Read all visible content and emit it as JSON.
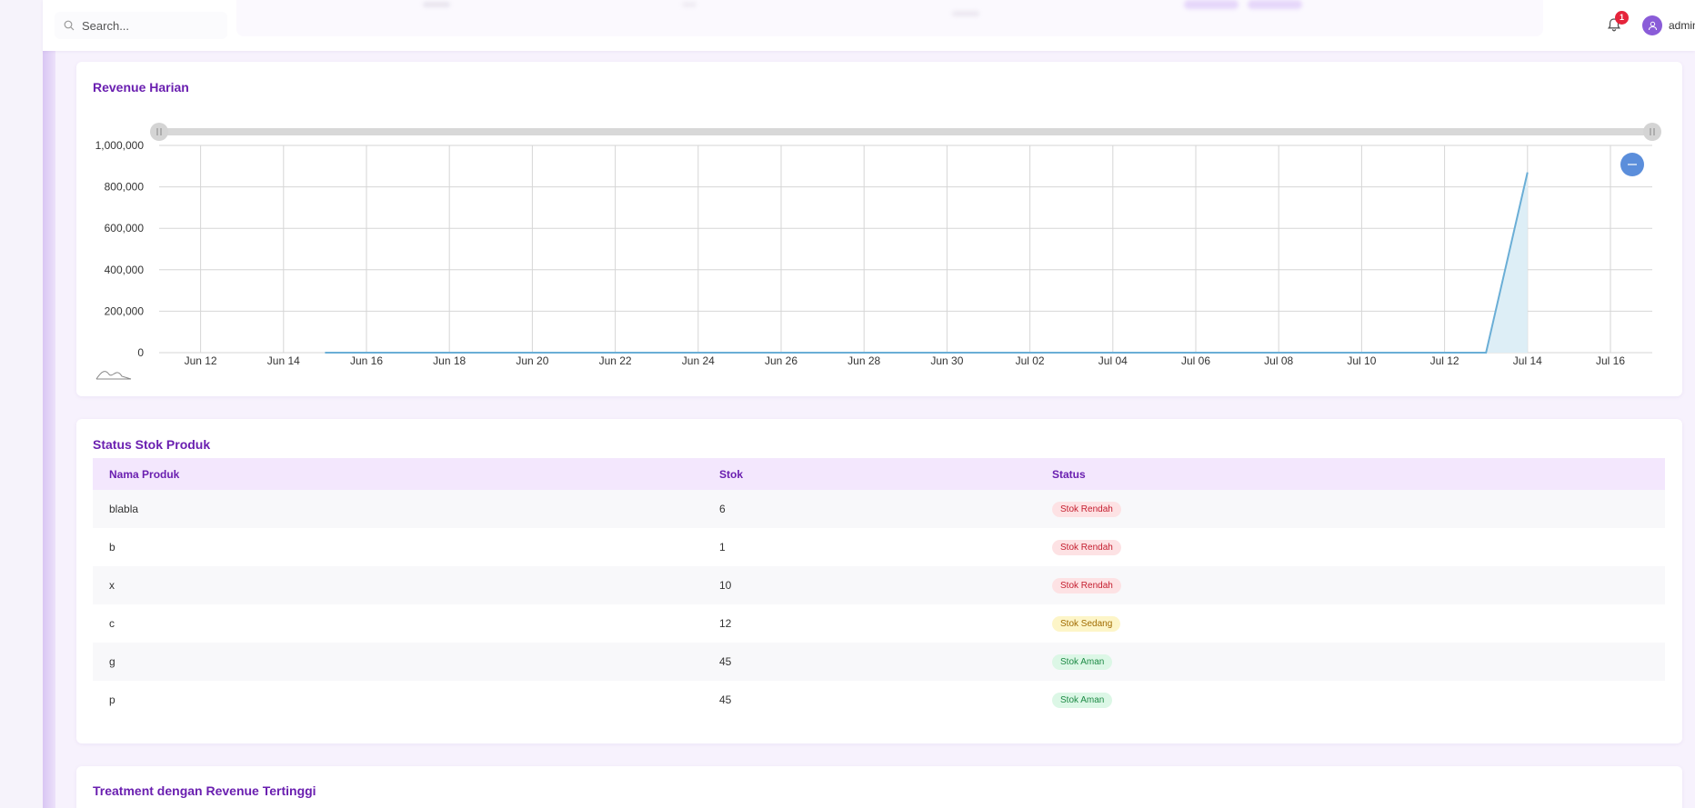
{
  "header": {
    "search_placeholder": "Search...",
    "notification_count": "1",
    "username": "admin",
    "icons": {
      "search": "search-icon",
      "bell": "bell-icon",
      "avatar": "user-icon"
    }
  },
  "revenue_card": {
    "title": "Revenue Harian",
    "icons": {
      "zoom_reset": "minus-circle-icon",
      "range_handle": "drag-handle-icon",
      "overview": "mini-sparkline-icon"
    }
  },
  "chart_data": {
    "type": "area",
    "x": [
      "Jun 15",
      "Jun 16",
      "Jun 17",
      "Jun 18",
      "Jun 19",
      "Jun 20",
      "Jun 21",
      "Jun 22",
      "Jun 23",
      "Jun 24",
      "Jun 25",
      "Jun 26",
      "Jun 27",
      "Jun 28",
      "Jun 29",
      "Jun 30",
      "Jul 01",
      "Jul 02",
      "Jul 03",
      "Jul 04",
      "Jul 05",
      "Jul 06",
      "Jul 07",
      "Jul 08",
      "Jul 09",
      "Jul 10",
      "Jul 11",
      "Jul 12",
      "Jul 13",
      "Jul 14"
    ],
    "values": [
      0,
      0,
      0,
      0,
      0,
      0,
      0,
      0,
      0,
      0,
      0,
      0,
      0,
      0,
      0,
      0,
      0,
      0,
      0,
      0,
      0,
      0,
      0,
      0,
      0,
      0,
      0,
      0,
      0,
      870000
    ],
    "x_ticks": [
      "Jun 12",
      "Jun 14",
      "Jun 16",
      "Jun 18",
      "Jun 20",
      "Jun 22",
      "Jun 24",
      "Jun 26",
      "Jun 28",
      "Jun 30",
      "Jul 02",
      "Jul 04",
      "Jul 06",
      "Jul 08",
      "Jul 10",
      "Jul 12",
      "Jul 14",
      "Jul 16"
    ],
    "y_ticks": [
      "0",
      "200,000",
      "400,000",
      "600,000",
      "800,000",
      "1,000,000"
    ],
    "ylim": [
      0,
      1000000
    ],
    "grid": true,
    "colors": {
      "line": "#6aaed6",
      "fill": "#ddeef6"
    }
  },
  "stock_card": {
    "title": "Status Stok Produk",
    "columns": [
      "Nama Produk",
      "Stok",
      "Status"
    ],
    "rows": [
      {
        "name": "blabla",
        "stock": "6",
        "status": "Stok Rendah",
        "level": "low"
      },
      {
        "name": "b",
        "stock": "1",
        "status": "Stok Rendah",
        "level": "low"
      },
      {
        "name": "x",
        "stock": "10",
        "status": "Stok Rendah",
        "level": "low"
      },
      {
        "name": "c",
        "stock": "12",
        "status": "Stok Sedang",
        "level": "mid"
      },
      {
        "name": "g",
        "stock": "45",
        "status": "Stok Aman",
        "level": "safe"
      },
      {
        "name": "p",
        "stock": "45",
        "status": "Stok Aman",
        "level": "safe"
      }
    ]
  },
  "treatment_card": {
    "title": "Treatment dengan Revenue Tertinggi"
  },
  "colors": {
    "accent": "#6a1fb0",
    "header_row": "#f3e7fd",
    "badge_low": "#fde2e4",
    "badge_mid": "#fdf5c8",
    "badge_safe": "#dcf7e6",
    "notification": "#e5243b"
  }
}
